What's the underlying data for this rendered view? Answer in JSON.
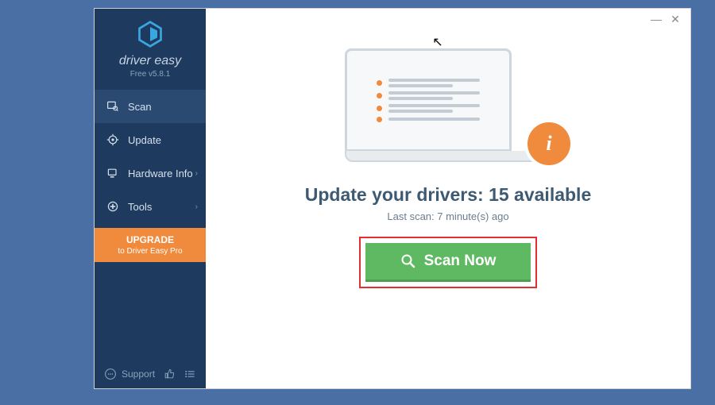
{
  "brand": {
    "title": "driver easy",
    "subtitle": "Free v5.8.1"
  },
  "nav": {
    "scan": "Scan",
    "update": "Update",
    "hardware": "Hardware Info",
    "tools": "Tools"
  },
  "upgrade": {
    "title": "UPGRADE",
    "subtitle": "to Driver Easy Pro"
  },
  "footer": {
    "support": "Support"
  },
  "main": {
    "heading": "Update your drivers: 15 available",
    "last_scan": "Last scan: 7 minute(s) ago",
    "scan_button": "Scan Now"
  },
  "window": {
    "minimize": "—",
    "close": "✕"
  }
}
